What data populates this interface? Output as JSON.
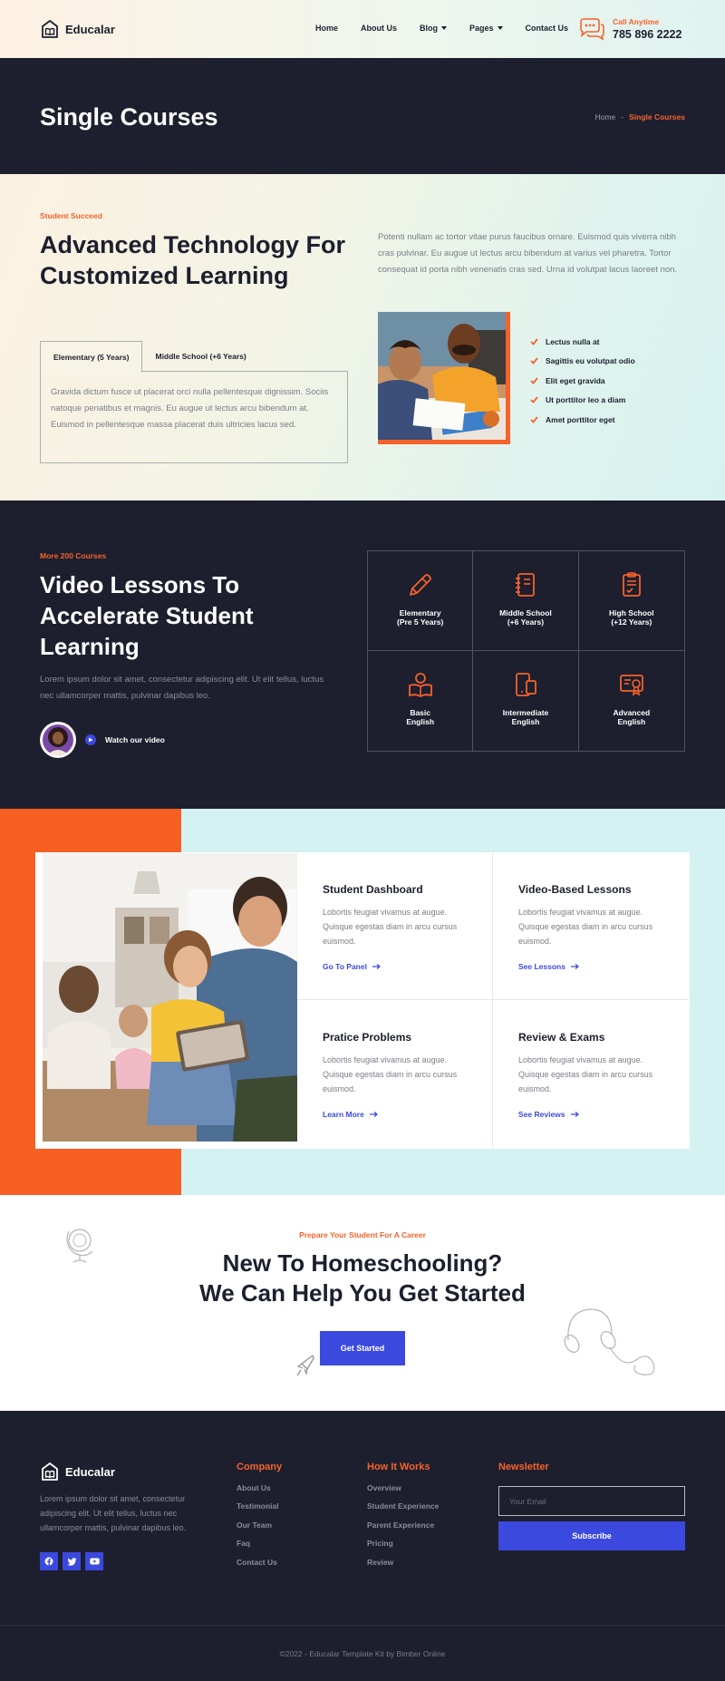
{
  "brand": {
    "name": "Educalar",
    "accent": "#f5622a",
    "primary": "#3b49df",
    "dark": "#1d1f2e"
  },
  "nav": {
    "items": [
      "Home",
      "About Us",
      "Blog",
      "Pages",
      "Contact Us"
    ]
  },
  "call": {
    "label": "Call Anytime",
    "number": "785 896 2222"
  },
  "page_header": {
    "title": "Single Courses",
    "breadcrumb_home": "Home",
    "breadcrumb_sep": "-",
    "breadcrumb_current": "Single Courses"
  },
  "intro": {
    "eyebrow": "Student Succeed",
    "heading": "Advanced Technology For Customized Learning",
    "tabs": [
      "Elementary (5 Years)",
      "Middle School (+6 Years)"
    ],
    "tab_content": "Gravida dictum fusce ut placerat orci nulla pellentesque dignissim. Sociis natoque penatibus et magnis. Eu augue ut lectus arcu bibendum at. Euismod in pellentesque massa placerat duis ultricies lacus sed.",
    "paragraph": "Potenti nullam ac tortor vitae purus faucibus ornare. Euismod quis viverra nibh cras pulvinar. Eu augue ut lectus arcu bibendum at varius vel pharetra. Tortor consequat id porta nibh venenatis cras sed. Urna id volutpat lacus laoreet non.",
    "checklist": [
      "Lectus nulla at",
      "Sagittis eu volutpat odio",
      "Elit eget gravida",
      "Ut porttitor leo a diam",
      "Amet porttitor eget"
    ]
  },
  "lessons": {
    "eyebrow": "More 200 Courses",
    "heading": "Video Lessons To Accelerate Student Learning",
    "paragraph": "Lorem ipsum dolor sit amet, consectetur adipiscing elit. Ut elit tellus, luctus nec ullamcorper mattis, pulvinar dapibus leo.",
    "watch_label": "Watch our video",
    "courses": [
      {
        "label": "Elementary\n(Pre 5 Years)",
        "icon": "pencil-icon"
      },
      {
        "label": "Middle School\n(+6 Years)",
        "icon": "notebook-icon"
      },
      {
        "label": "High School\n(+12 Years)",
        "icon": "document-icon"
      },
      {
        "label": "Basic\nEnglish",
        "icon": "reader-icon"
      },
      {
        "label": "Intermediate\nEnglish",
        "icon": "devices-icon"
      },
      {
        "label": "Advanced\nEnglish",
        "icon": "certificate-icon"
      }
    ]
  },
  "features": [
    {
      "title": "Student Dashboard",
      "desc": "Lobortis feugiat vivamus at augue. Quisque egestas diam in arcu cursus euismod.",
      "link": "Go To Panel"
    },
    {
      "title": "Video-Based Lessons",
      "desc": "Lobortis feugiat vivamus at augue. Quisque egestas diam in arcu cursus euismod.",
      "link": "See Lessons"
    },
    {
      "title": "Pratice Problems",
      "desc": "Lobortis feugiat vivamus at augue. Quisque egestas diam in arcu cursus euismod.",
      "link": "Learn More"
    },
    {
      "title": "Review & Exams",
      "desc": "Lobortis feugiat vivamus at augue. Quisque egestas diam in arcu cursus euismod.",
      "link": "See Reviews"
    }
  ],
  "cta": {
    "eyebrow": "Prepare Your Student For A Career",
    "line1": "New To Homeschooling?",
    "line2": "We Can Help You Get Started",
    "button": "Get Started"
  },
  "footer": {
    "desc": "Lorem ipsum dolor sit amet, consectetur adipiscing elit. Ut elit tellus, luctus nec ullamcorper mattis, pulvinar dapibus leo.",
    "company": {
      "title": "Company",
      "links": [
        "About Us",
        "Testimonial",
        "Our Team",
        "Faq",
        "Contact Us"
      ]
    },
    "how": {
      "title": "How It Works",
      "links": [
        "Overview",
        "Student Experience",
        "Parent Experience",
        "Pricing",
        "Review"
      ]
    },
    "newsletter": {
      "title": "Newsletter",
      "placeholder": "Your Email",
      "button": "Subscribe"
    },
    "copyright": "©2022 - Educalar Template Kit by Bimber Online"
  }
}
